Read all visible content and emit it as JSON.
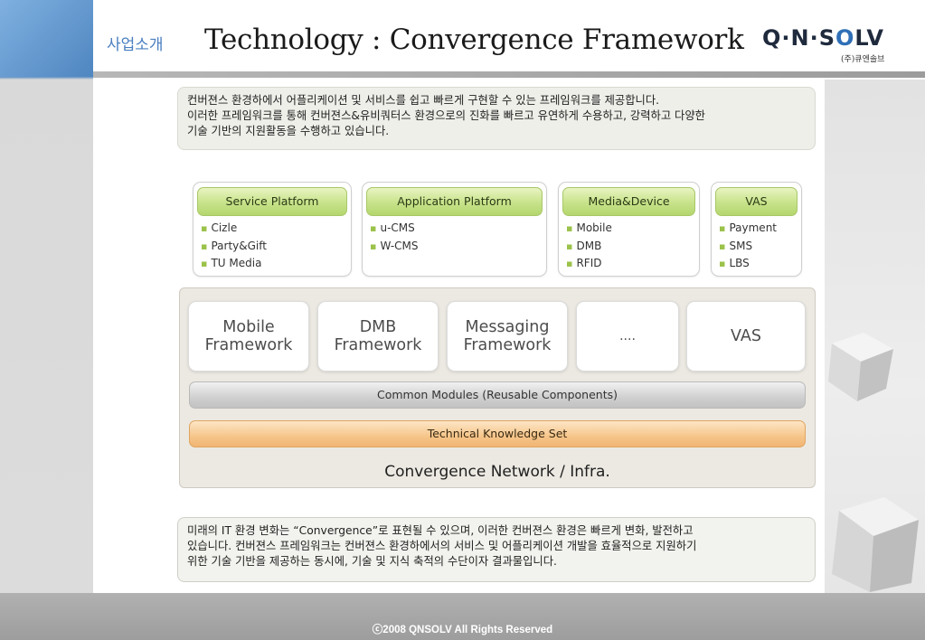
{
  "header": {
    "section_label": "사업소개",
    "title": "Technology : Convergence Framework",
    "logo_text_parts": [
      "Q·N·S",
      "O",
      "LV"
    ],
    "logo_subtitle": "(주)큐엔솔브"
  },
  "top_description": {
    "lines": [
      "컨버젼스 환경하에서 어플리케이션 및 서비스를 쉽고 빠르게 구현할 수 있는 프레임워크를 제공합니다.",
      "이러한 프레임워크를 통해 컨버젼스&유비쿼터스 환경으로의 진화를 빠르고 유연하게 수용하고, 강력하고 다양한",
      "기술 기반의 지원활동을 수행하고 있습니다."
    ]
  },
  "platforms": [
    {
      "title": "Service Platform",
      "items": [
        "Cizle",
        "Party&Gift",
        "TU Media"
      ]
    },
    {
      "title": "Application Platform",
      "items": [
        "u-CMS",
        "W-CMS"
      ]
    },
    {
      "title": "Media&Device",
      "items": [
        "Mobile",
        "DMB",
        "RFID"
      ]
    },
    {
      "title": "VAS",
      "items": [
        "Payment",
        "SMS",
        "LBS"
      ]
    }
  ],
  "framework": {
    "boxes": [
      {
        "line1": "Mobile",
        "line2": "Framework"
      },
      {
        "line1": "DMB",
        "line2": "Framework"
      },
      {
        "line1": "Messaging",
        "line2": "Framework"
      },
      {
        "line1": "....",
        "line2": ""
      },
      {
        "line1": "VAS",
        "line2": ""
      }
    ],
    "common_modules": "Common Modules (Reusable Components)",
    "technical_knowledge": "Technical Knowledge Set",
    "network_label": "Convergence Network / Infra."
  },
  "bottom_description": {
    "lines": [
      "미래의 IT 환경 변화는 “Convergence”로 표현될 수 있으며, 이러한 컨버젼스 환경은 빠르게 변화, 발전하고",
      "있습니다. 컨버젼스 프레임워크는 컨버젼스 환경하에서의 서비스 및 어플리케이션 개발을 효율적으로 지원하기",
      "위한 기술 기반을 제공하는 동시에, 기술 및 지식 축적의 수단이자 결과물입니다."
    ]
  },
  "footer": {
    "copyright": "ⓒ2008 QNSOLV All Rights Reserved"
  },
  "colors": {
    "accent_blue": "#4a7fc0",
    "pill_green": "#c7e38a",
    "tech_orange": "#f6c58a",
    "footer_gray": "#a8a8a8"
  }
}
